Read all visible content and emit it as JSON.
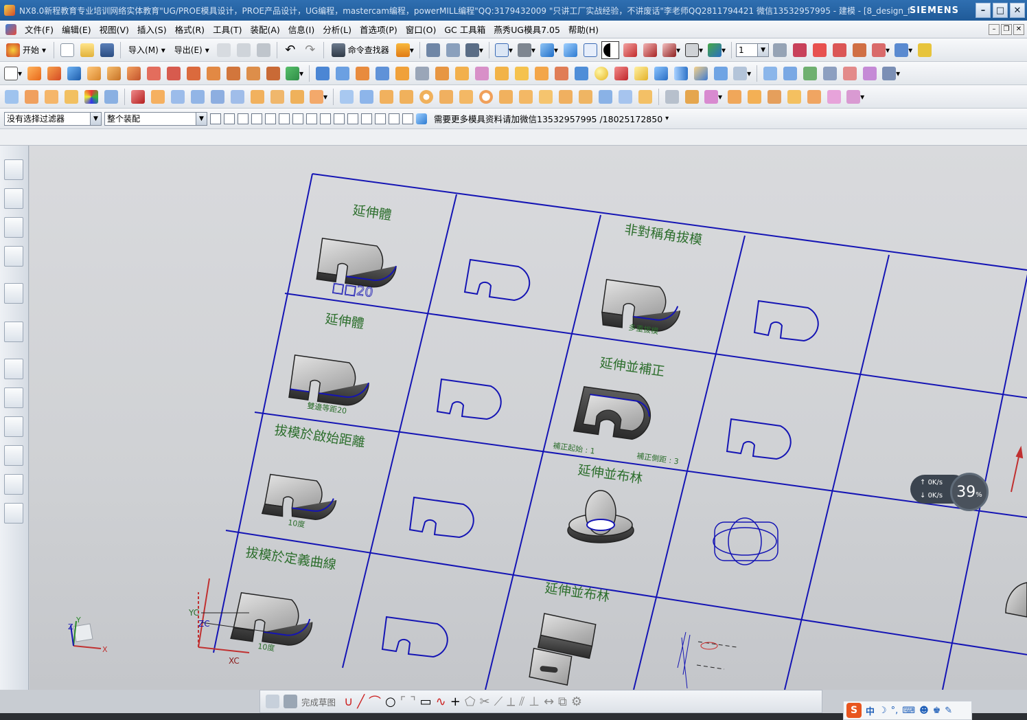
{
  "window": {
    "title": "NX8.0新程教育专业培训网络实体教育\"UG/PROE模具设计，PROE产品设计，UG编程，mastercam编程，powerMILL编程\"QQ:3179432009 \"只讲工厂实战经验，不讲废话\"李老师QQ2811794421 微信13532957995 - 建模 - [8_design_feature....",
    "brand": "SIEMENS",
    "minimize": "–",
    "maximize": "□",
    "close": "✕"
  },
  "menu": [
    "文件(F)",
    "编辑(E)",
    "视图(V)",
    "插入(S)",
    "格式(R)",
    "工具(T)",
    "装配(A)",
    "信息(I)",
    "分析(L)",
    "首选项(P)",
    "窗口(O)",
    "GC 工具箱",
    "燕秀UG模具7.05",
    "帮助(H)"
  ],
  "toolbar1": {
    "start": "开始",
    "import": "导入(M)",
    "export": "导出(E)",
    "command_finder": "命令查找器",
    "layer_value": "1"
  },
  "filterbar": {
    "selection_filter": "没有选择过滤器",
    "assembly_scope": "整个装配",
    "notice": "需要更多模具资料请加微信13532957995 /18025172850"
  },
  "viewport": {
    "cells": {
      "r0c0": "延伸體",
      "r0c0_note": "□□20",
      "r0c2": "非對稱角拔模",
      "r0c2_note": "多重拔模",
      "r1c0": "延伸體",
      "r1c0_note": "雙邊等距20",
      "r1c2": "延伸並補正",
      "r1c2_note_a": "補正起始 : 1",
      "r1c2_note_b": "補正側距 : 3",
      "r2c0": "拔模於啟始距離",
      "r2c0_note": "10度",
      "r2c2": "延伸並布林",
      "r3c0": "拔模於定義曲線",
      "r3c0_note": "10度",
      "r3c2": "延伸並布林"
    },
    "axis": {
      "x": "X",
      "y": "Y",
      "z": "Z",
      "xc": "XC",
      "yc": "YC",
      "zc": "ZC"
    },
    "colors": {
      "grid": "#1414b4",
      "label": "#2c6e2c",
      "background": "#d3d5d8"
    }
  },
  "netmon": {
    "up": "0K/s",
    "down": "0K/s",
    "percent": "39",
    "unit": "%"
  },
  "sketchbar": {
    "finish": "完成草图"
  },
  "ime": {
    "logo": "S",
    "lang": "中"
  }
}
